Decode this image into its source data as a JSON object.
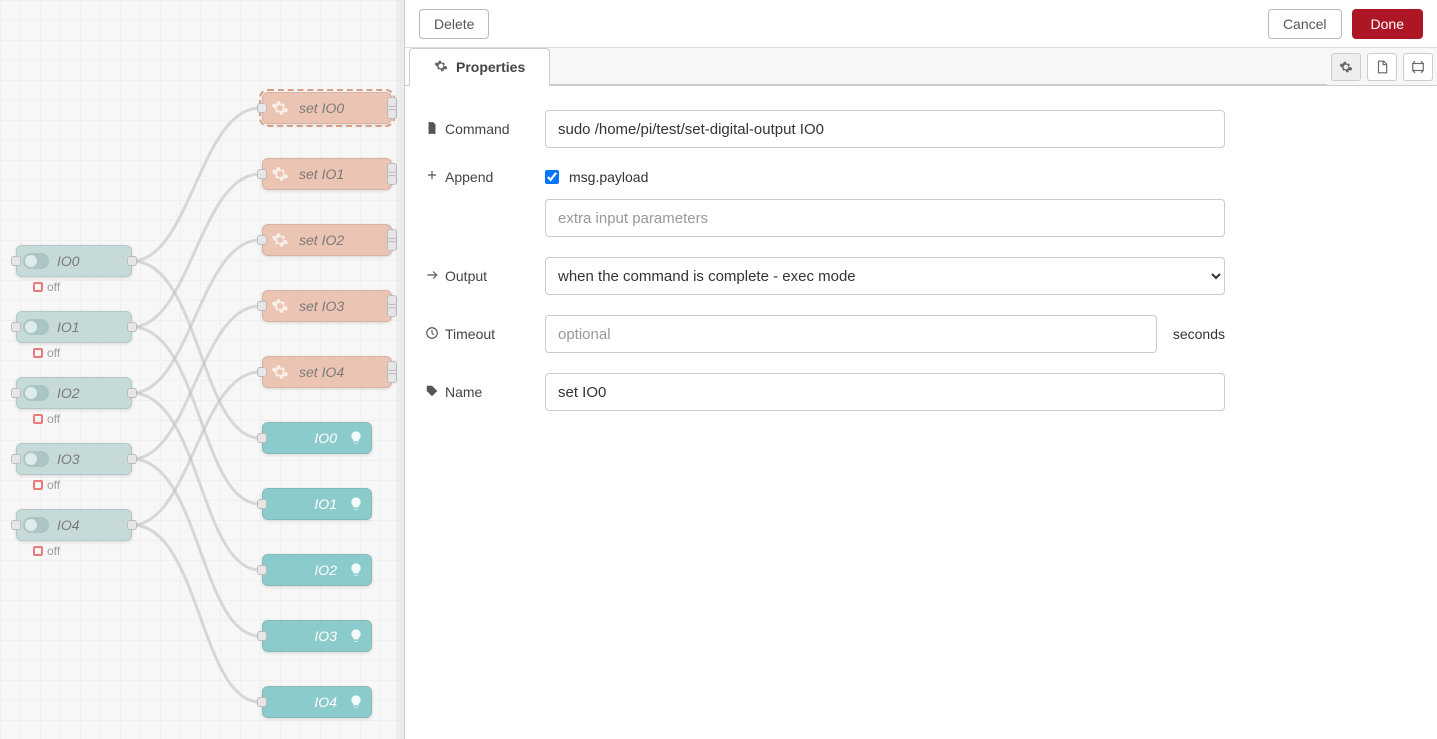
{
  "header": {
    "delete_label": "Delete",
    "cancel_label": "Cancel",
    "done_label": "Done"
  },
  "tabs": {
    "properties_label": "Properties"
  },
  "form": {
    "command": {
      "label": "Command",
      "value": "sudo /home/pi/test/set-digital-output IO0"
    },
    "append": {
      "label": "Append",
      "checked": true,
      "check_label": "msg.payload",
      "extra_placeholder": "extra input parameters",
      "extra_value": ""
    },
    "output": {
      "label": "Output",
      "value": "when the command is complete - exec mode"
    },
    "timeout": {
      "label": "Timeout",
      "placeholder": "optional",
      "value": "",
      "suffix": "seconds"
    },
    "name": {
      "label": "Name",
      "value": "set IO0"
    }
  },
  "canvas": {
    "switch_nodes": [
      {
        "label": "IO0",
        "status": "off"
      },
      {
        "label": "IO1",
        "status": "off"
      },
      {
        "label": "IO2",
        "status": "off"
      },
      {
        "label": "IO3",
        "status": "off"
      },
      {
        "label": "IO4",
        "status": "off"
      }
    ],
    "exec_nodes": [
      {
        "label": "set IO0",
        "active": true
      },
      {
        "label": "set IO1",
        "active": false
      },
      {
        "label": "set IO2",
        "active": false
      },
      {
        "label": "set IO3",
        "active": false
      },
      {
        "label": "set IO4",
        "active": false
      }
    ],
    "debug_nodes": [
      {
        "label": "IO0"
      },
      {
        "label": "IO1"
      },
      {
        "label": "IO2"
      },
      {
        "label": "IO3"
      },
      {
        "label": "IO4"
      }
    ]
  }
}
